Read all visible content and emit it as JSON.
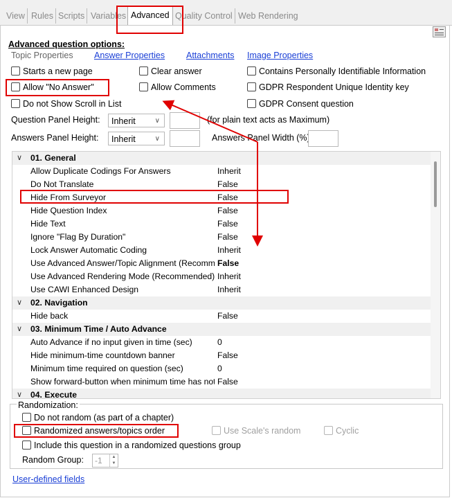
{
  "tabs": [
    {
      "label": "View"
    },
    {
      "label": "Rules"
    },
    {
      "label": "Scripts"
    },
    {
      "label": "Variables"
    },
    {
      "label": "Advanced"
    },
    {
      "label": "Quality Control"
    },
    {
      "label": "Web Rendering"
    }
  ],
  "header": {
    "title": "Advanced question options:",
    "links": [
      "Topic Properties",
      "Answer Properties",
      "Attachments",
      "Image Properties"
    ]
  },
  "options": [
    {
      "label": "Starts a new page"
    },
    {
      "label": "Clear answer"
    },
    {
      "label": "Contains Personally Identifiable Information"
    },
    {
      "label": "Allow \"No Answer\""
    },
    {
      "label": "Allow Comments"
    },
    {
      "label": "GDPR Respondent Unique Identity key"
    },
    {
      "label": "Do not Show Scroll in List"
    },
    {
      "label": "GDPR Consent question"
    }
  ],
  "question_panel": {
    "label": "Question Panel Height:",
    "value": "Inherit",
    "hint": "(for plain text acts as Maximum)"
  },
  "answers_panel": {
    "label": "Answers Panel Height:",
    "value": "Inherit",
    "width_label": "Answers Panel Width (%):"
  },
  "grid": [
    {
      "kind": "cat",
      "label": "01. General"
    },
    {
      "label": "Allow Duplicate Codings For Answers",
      "value": "Inherit"
    },
    {
      "label": "Do Not Translate",
      "value": "False"
    },
    {
      "label": "Hide From Surveyor",
      "value": "False"
    },
    {
      "label": "Hide Question Index",
      "value": "False"
    },
    {
      "label": "Hide Text",
      "value": "False"
    },
    {
      "label": "Ignore \"Flag By Duration\"",
      "value": "False"
    },
    {
      "label": "Lock Answer Automatic Coding",
      "value": "Inherit"
    },
    {
      "label": "Use Advanced Answer/Topic Alignment (Recommended)",
      "value": "False",
      "bold": true
    },
    {
      "label": "Use Advanced Rendering Mode (Recommended)",
      "value": "Inherit"
    },
    {
      "label": "Use CAWI Enhanced Design",
      "value": "Inherit"
    },
    {
      "kind": "cat",
      "label": "02. Navigation"
    },
    {
      "label": "Hide back",
      "value": "False"
    },
    {
      "kind": "cat",
      "label": "03. Minimum Time / Auto Advance"
    },
    {
      "label": "Auto Advance if no input given in time (sec)",
      "value": "0"
    },
    {
      "label": "Hide minimum-time countdown banner",
      "value": "False"
    },
    {
      "label": "Minimum time required on question (sec)",
      "value": "0"
    },
    {
      "label": "Show forward-button when minimum time has not passed",
      "value": "False"
    },
    {
      "kind": "cat",
      "label": "04. Execute"
    }
  ],
  "randomization": {
    "legend": "Randomization:",
    "options": [
      {
        "label": "Do not random (as part of a chapter)"
      },
      {
        "label": "Randomized answers/topics order"
      },
      {
        "label": "Use Scale's random"
      },
      {
        "label": "Cyclic"
      },
      {
        "label": "Include this question in a randomized questions group"
      }
    ],
    "group_label": "Random Group:",
    "group_value": "-1"
  },
  "footer_link": "User-defined fields",
  "colors": {
    "highlight": "#e00000",
    "link": "#1a3fd6"
  },
  "icons": {
    "toolbar": "properties-grid-icon"
  }
}
